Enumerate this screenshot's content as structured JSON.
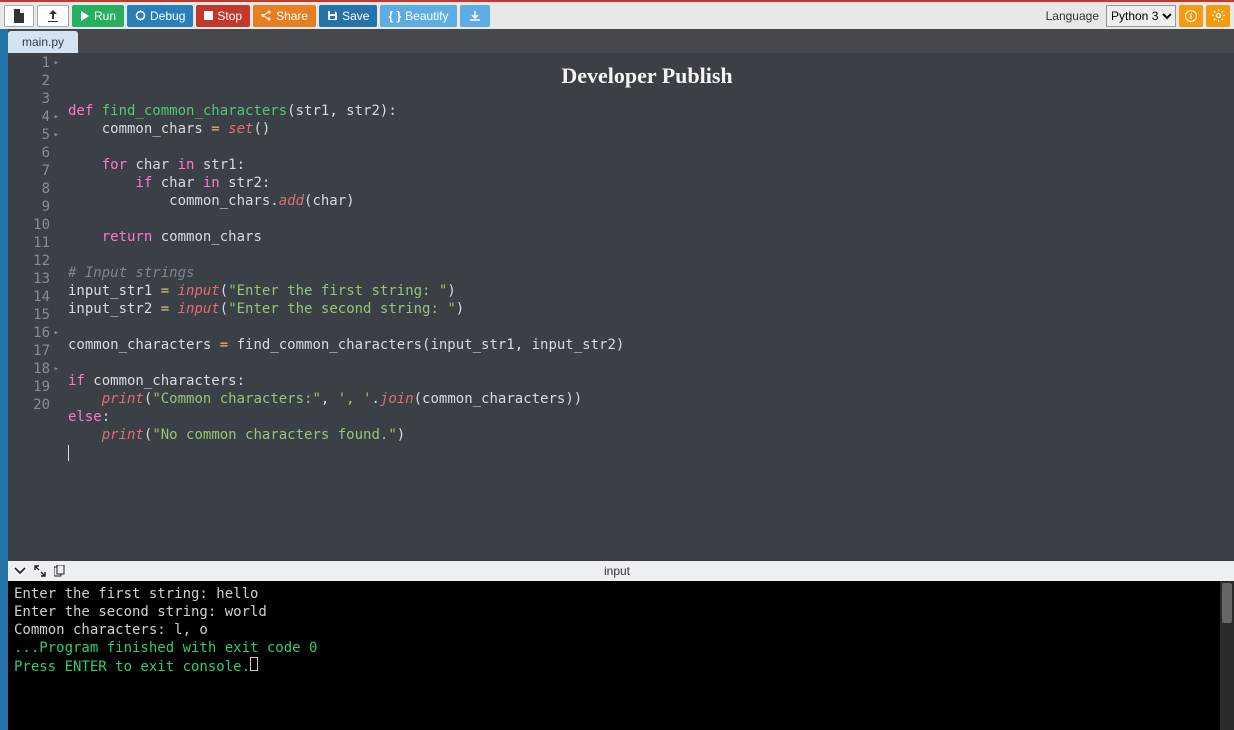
{
  "toolbar": {
    "run": "Run",
    "debug": "Debug",
    "stop": "Stop",
    "share": "Share",
    "save": "Save",
    "beautify": "Beautify"
  },
  "language": {
    "label": "Language",
    "selected": "Python 3"
  },
  "tab": {
    "name": "main.py"
  },
  "watermark": "Developer Publish",
  "code": {
    "line_count": 20,
    "fold_lines": [
      1,
      4,
      5,
      16,
      18
    ],
    "lines": [
      {
        "n": 1,
        "segs": [
          [
            "kw",
            "def"
          ],
          [
            "plain",
            " "
          ],
          [
            "fn",
            "find_common_characters"
          ],
          [
            "plain",
            "(str1, str2):"
          ]
        ]
      },
      {
        "n": 2,
        "segs": [
          [
            "plain",
            "    common_chars "
          ],
          [
            "op",
            "="
          ],
          [
            "plain",
            " "
          ],
          [
            "builtin",
            "set"
          ],
          [
            "plain",
            "()"
          ]
        ]
      },
      {
        "n": 3,
        "segs": [
          [
            "plain",
            ""
          ]
        ]
      },
      {
        "n": 4,
        "segs": [
          [
            "plain",
            "    "
          ],
          [
            "kw",
            "for"
          ],
          [
            "plain",
            " char "
          ],
          [
            "kw",
            "in"
          ],
          [
            "plain",
            " str1:"
          ]
        ]
      },
      {
        "n": 5,
        "segs": [
          [
            "plain",
            "        "
          ],
          [
            "kw",
            "if"
          ],
          [
            "plain",
            " char "
          ],
          [
            "kw",
            "in"
          ],
          [
            "plain",
            " str2:"
          ]
        ]
      },
      {
        "n": 6,
        "segs": [
          [
            "plain",
            "            common_chars."
          ],
          [
            "builtin",
            "add"
          ],
          [
            "plain",
            "(char)"
          ]
        ]
      },
      {
        "n": 7,
        "segs": [
          [
            "plain",
            ""
          ]
        ]
      },
      {
        "n": 8,
        "segs": [
          [
            "plain",
            "    "
          ],
          [
            "kw",
            "return"
          ],
          [
            "plain",
            " common_chars"
          ]
        ]
      },
      {
        "n": 9,
        "segs": [
          [
            "plain",
            ""
          ]
        ]
      },
      {
        "n": 10,
        "segs": [
          [
            "cmt",
            "# Input strings"
          ]
        ]
      },
      {
        "n": 11,
        "segs": [
          [
            "plain",
            "input_str1 "
          ],
          [
            "op",
            "="
          ],
          [
            "plain",
            " "
          ],
          [
            "builtin",
            "input"
          ],
          [
            "plain",
            "("
          ],
          [
            "str",
            "\"Enter the first string: \""
          ],
          [
            "plain",
            ")"
          ]
        ]
      },
      {
        "n": 12,
        "segs": [
          [
            "plain",
            "input_str2 "
          ],
          [
            "op",
            "="
          ],
          [
            "plain",
            " "
          ],
          [
            "builtin",
            "input"
          ],
          [
            "plain",
            "("
          ],
          [
            "str",
            "\"Enter the second string: \""
          ],
          [
            "plain",
            ")"
          ]
        ]
      },
      {
        "n": 13,
        "segs": [
          [
            "plain",
            ""
          ]
        ]
      },
      {
        "n": 14,
        "segs": [
          [
            "plain",
            "common_characters "
          ],
          [
            "op",
            "="
          ],
          [
            "plain",
            " find_common_characters(input_str1, input_str2)"
          ]
        ]
      },
      {
        "n": 15,
        "segs": [
          [
            "plain",
            ""
          ]
        ]
      },
      {
        "n": 16,
        "segs": [
          [
            "kw",
            "if"
          ],
          [
            "plain",
            " common_characters:"
          ]
        ]
      },
      {
        "n": 17,
        "segs": [
          [
            "plain",
            "    "
          ],
          [
            "builtin",
            "print"
          ],
          [
            "plain",
            "("
          ],
          [
            "str",
            "\"Common characters:\""
          ],
          [
            "plain",
            ", "
          ],
          [
            "str",
            "', '"
          ],
          [
            "plain",
            "."
          ],
          [
            "builtin",
            "join"
          ],
          [
            "plain",
            "(common_characters))"
          ]
        ]
      },
      {
        "n": 18,
        "segs": [
          [
            "kw",
            "else"
          ],
          [
            "plain",
            ":"
          ]
        ]
      },
      {
        "n": 19,
        "segs": [
          [
            "plain",
            "    "
          ],
          [
            "builtin",
            "print"
          ],
          [
            "plain",
            "("
          ],
          [
            "str",
            "\"No common characters found.\""
          ],
          [
            "plain",
            ")"
          ]
        ]
      },
      {
        "n": 20,
        "segs": [
          [
            "plain",
            ""
          ]
        ]
      }
    ]
  },
  "console": {
    "label": "input",
    "lines": [
      {
        "cls": "",
        "text": "Enter the first string: hello"
      },
      {
        "cls": "",
        "text": "Enter the second string: world"
      },
      {
        "cls": "",
        "text": "Common characters: l, o"
      },
      {
        "cls": "",
        "text": ""
      },
      {
        "cls": "",
        "text": ""
      },
      {
        "cls": "term-green",
        "text": "...Program finished with exit code 0"
      },
      {
        "cls": "term-green",
        "text": "Press ENTER to exit console."
      }
    ]
  }
}
